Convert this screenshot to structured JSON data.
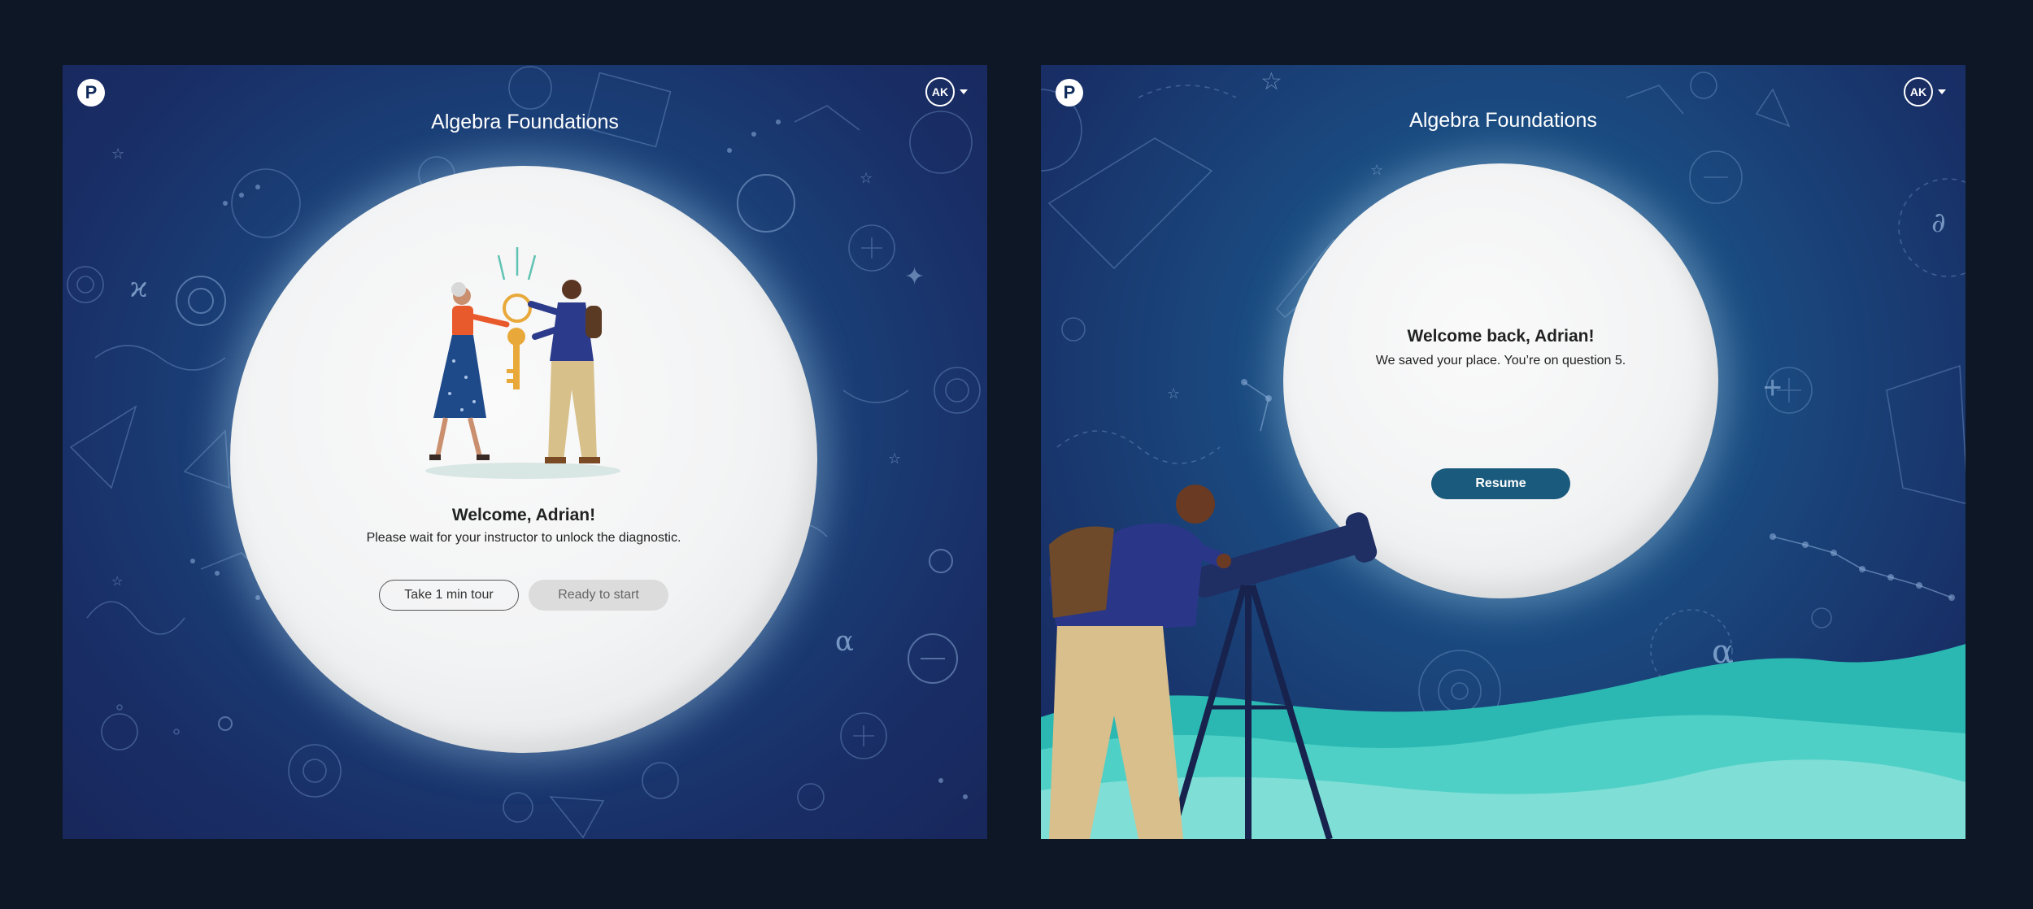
{
  "left_screen": {
    "app_title": "Algebra Foundations",
    "user_initials": "AK",
    "welcome_title": "Welcome, Adrian!",
    "welcome_subtitle": "Please wait for your instructor to unlock the diagnostic.",
    "tour_button": "Take 1 min tour",
    "start_button": "Ready to start"
  },
  "right_screen": {
    "app_title": "Algebra Foundations",
    "user_initials": "AK",
    "welcome_title": "Welcome back, Adrian!",
    "welcome_subtitle": "We saved your place. You’re on question 5.",
    "resume_button": "Resume"
  },
  "logo": {
    "letter": "P"
  },
  "colors": {
    "page_bg": "#0e1726",
    "panel_blue": "#1b447c",
    "resume_button": "#1a5a7c",
    "teal_hills": "#2ec4bd",
    "key_gold": "#e8a93a"
  }
}
